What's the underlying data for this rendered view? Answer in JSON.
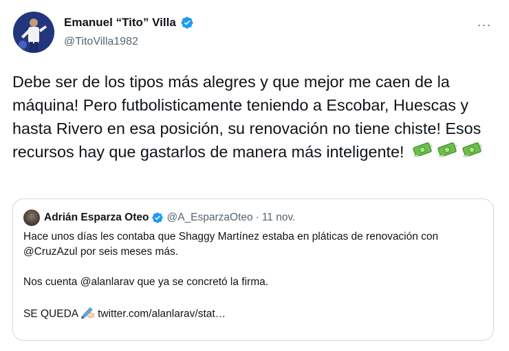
{
  "author": {
    "display_name": "Emanuel “Tito” Villa",
    "handle": "@TitoVilla1982"
  },
  "more_label": "···",
  "tweet": {
    "text": "Debe ser de los tipos más alegres y que mejor me caen de la máquina! Pero futbolisticamente teniendo a Escobar, Huescas y hasta Rivero en esa posición, su renovación no tiene chiste! Esos recursos hay que gastarlos de manera más inteligente!",
    "emoji": [
      "money-with-wings",
      "money-with-wings",
      "money-with-wings"
    ]
  },
  "quote": {
    "display_name": "Adrián Esparza Oteo",
    "handle": "@A_EsparzaOteo",
    "separator": "·",
    "time": "11 nov.",
    "paragraph_1": "Hace unos días les contaba que Shaggy Martínez estaba en pláticas de renovación con @CruzAzul por seis meses más.",
    "paragraph_2": "Nos cuenta @alanlarav que ya se concretó la firma.",
    "paragraph_3_prefix": "SE QUEDA",
    "paragraph_3_icon": "writing-hand",
    "paragraph_3_link": "twitter.com/alanlarav/stat…"
  },
  "colors": {
    "verified": "#1d9bf0",
    "secondary_text": "#536471",
    "border": "#cfd9de"
  }
}
